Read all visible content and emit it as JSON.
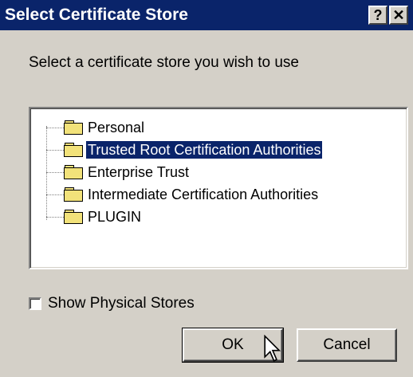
{
  "window": {
    "title": "Select Certificate Store",
    "help_glyph": "?",
    "close_glyph": "✕"
  },
  "prompt": "Select a certificate store you wish to use",
  "tree": {
    "items": [
      {
        "label": "Personal",
        "selected": false
      },
      {
        "label": "Trusted Root Certification Authorities",
        "selected": true
      },
      {
        "label": "Enterprise Trust",
        "selected": false
      },
      {
        "label": "Intermediate Certification Authorities",
        "selected": false
      },
      {
        "label": "PLUGIN",
        "selected": false
      }
    ]
  },
  "show_physical": {
    "checked": false,
    "label": "Show Physical Stores"
  },
  "buttons": {
    "ok": "OK",
    "cancel": "Cancel"
  },
  "colors": {
    "titlebar": "#0a246a",
    "face": "#d4d0c8",
    "selection": "#0a246a",
    "folder": "#f2e27a"
  },
  "icons": {
    "folder": "folder-icon",
    "cursor": "mouse-pointer-icon"
  }
}
